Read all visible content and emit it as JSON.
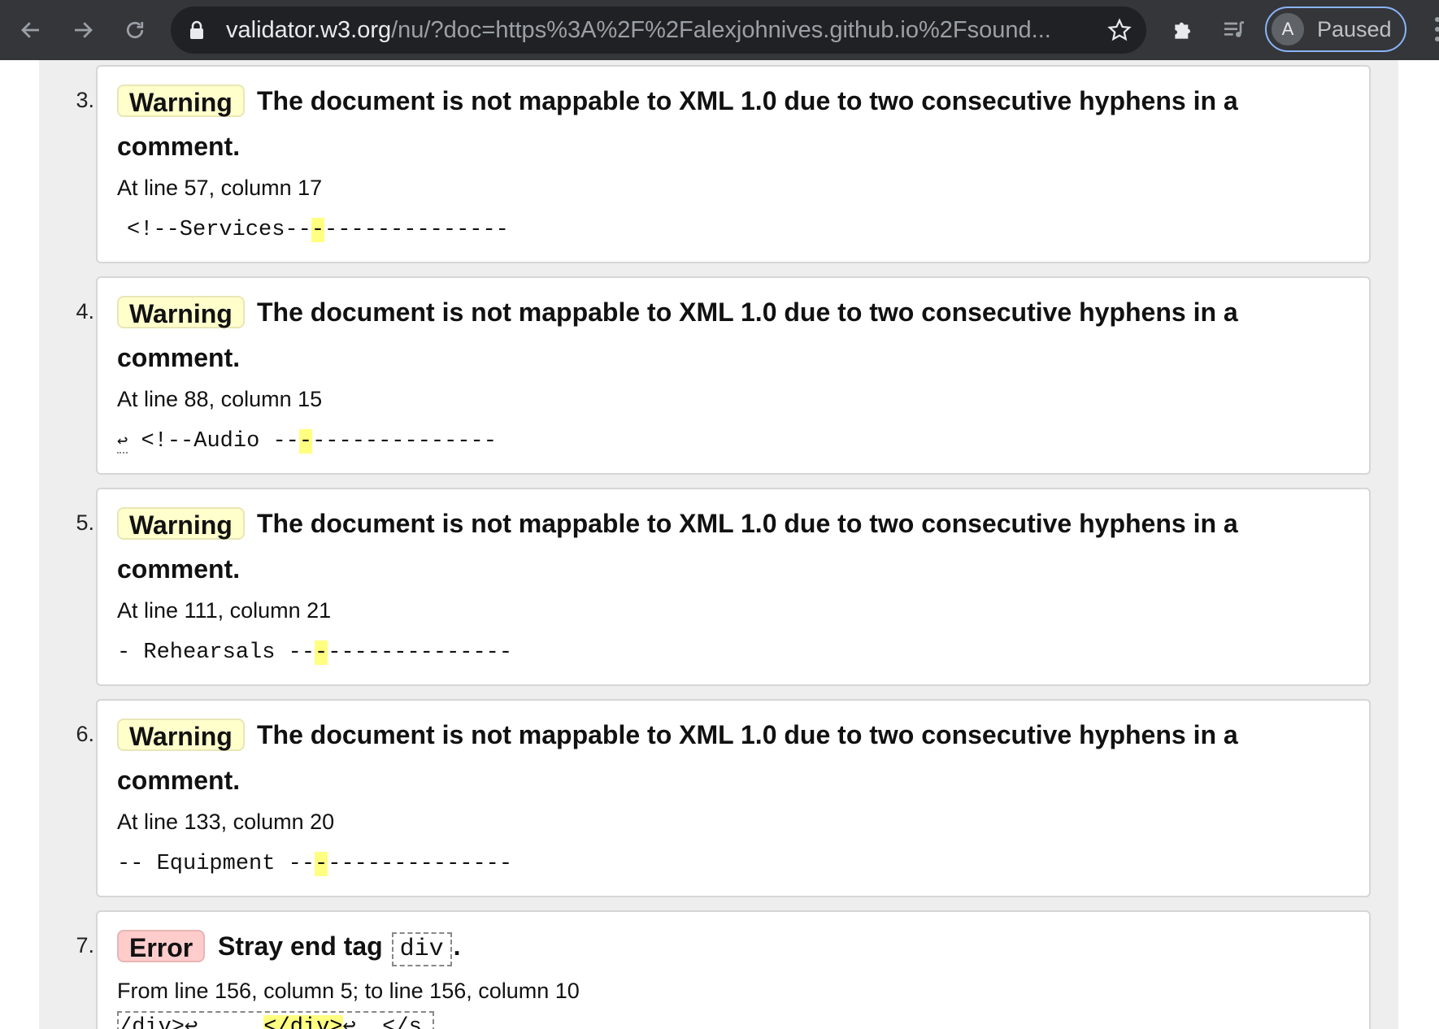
{
  "browser": {
    "url_host": "validator.w3.org",
    "url_path": "/nu/?doc=https%3A%2F%2Falexjohnives.github.io%2Fsound...",
    "profile_initial": "A",
    "profile_status": "Paused"
  },
  "messages": [
    {
      "number": "3.",
      "type": "Warning",
      "text_line1": "The document is not mappable to XML 1.0 due to two consecutive hyphens in a",
      "text_line2": "comment.",
      "location": "At line 57, column 17",
      "extract_before": "<!--Services--",
      "extract_highlight": "-",
      "extract_after": "--------------"
    },
    {
      "number": "4.",
      "type": "Warning",
      "text_line1": "The document is not mappable to XML 1.0 due to two consecutive hyphens in a",
      "text_line2": "comment.",
      "location": "At line 88, column 15",
      "extract_lf": "↩",
      "extract_before": " <!--Audio --",
      "extract_highlight": "-",
      "extract_after": "--------------"
    },
    {
      "number": "5.",
      "type": "Warning",
      "text_line1": "The document is not mappable to XML 1.0 due to two consecutive hyphens in a",
      "text_line2": "comment.",
      "location": "At line 111, column 21",
      "extract_before": "- Rehearsals --",
      "extract_highlight": "-",
      "extract_after": "--------------"
    },
    {
      "number": "6.",
      "type": "Warning",
      "text_line1": "The document is not mappable to XML 1.0 due to two consecutive hyphens in a",
      "text_line2": "comment.",
      "location": "At line 133, column 20",
      "extract_before": "-- Equipment --",
      "extract_highlight": "-",
      "extract_after": "--------------"
    },
    {
      "number": "7.",
      "type": "Error",
      "text_before": "Stray end tag",
      "code": "div",
      "text_after": ".",
      "location": "From line 156, column 5; to line 156, column 10",
      "extract_before": "/div>↩     ",
      "extract_highlight": "</div>",
      "extract_after": "↩  </s"
    }
  ]
}
